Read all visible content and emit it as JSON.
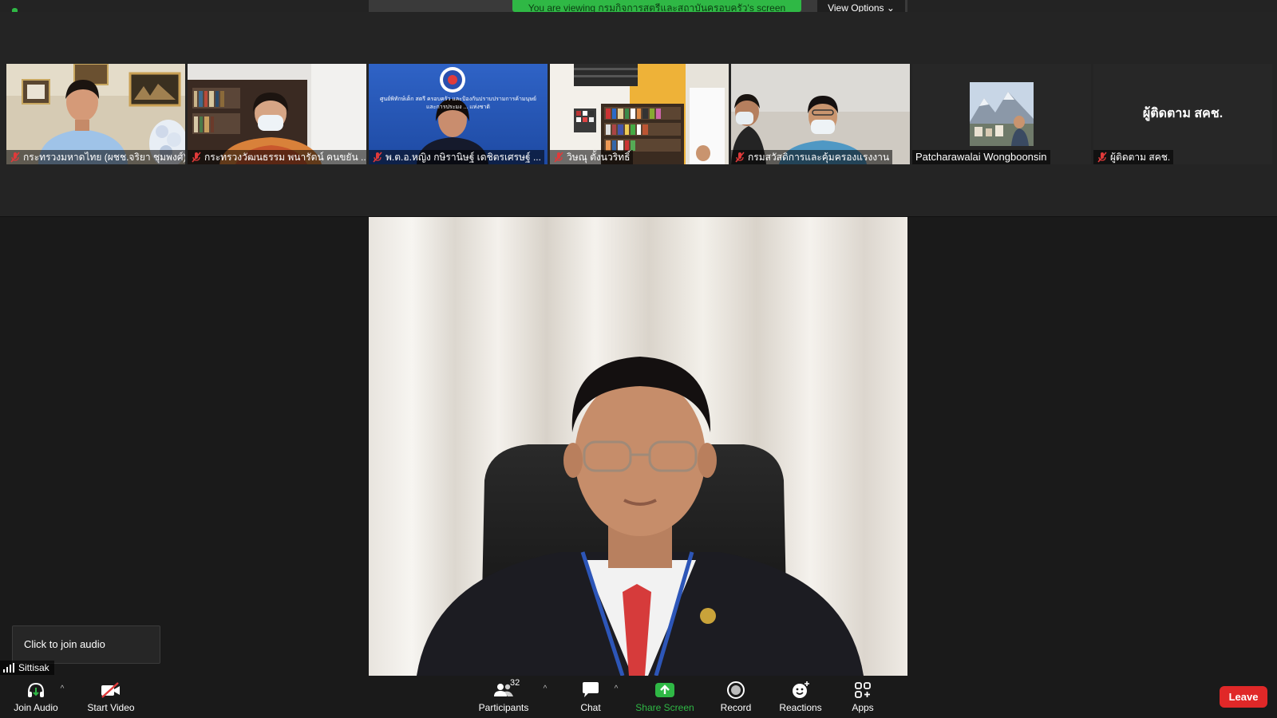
{
  "banner": {
    "viewing_text": "You are viewing กรมกิจการสตรีและสถาบันครอบครัว's screen",
    "view_options_label": "View Options ⌄"
  },
  "gallery": {
    "tiles": [
      {
        "name": "กระทรวงมหาดไทย (ผชช.จริยา ชุมพงศ์)",
        "muted": true
      },
      {
        "name": "กระทรวงวัฒนธรรม พนารัตน์ คนขยัน ...",
        "muted": true
      },
      {
        "name": "พ.ต.อ.หญิง กษิรานิษฐ์ เดชิตรเศรษฐ์ ...",
        "muted": true
      },
      {
        "name": "วิษณุ ตั้งนวริทธิ์",
        "muted": true
      },
      {
        "name": "กรมสวัสดิการและคุ้มครองแรงงาน",
        "muted": true
      },
      {
        "name": "Patcharawalai Wongboonsin",
        "muted": false
      },
      {
        "name": "ผู้ติดตาม สคช.",
        "muted": true,
        "center_label": "ผู้ติดตาม สคช."
      }
    ],
    "tile3_banner_line1": "ศูนย์พิทักษ์เด็ก สตรี ครอบครัว และป้องกันปราบปรามการค้ามนุษย์",
    "tile3_banner_line2": "และการประมง ... แห่งชาติ"
  },
  "popup": {
    "text": "Click to join audio"
  },
  "self_view": {
    "name": "Sittisak"
  },
  "toolbar": {
    "join_audio": "Join Audio",
    "start_video": "Start Video",
    "participants": "Participants",
    "participants_count": "32",
    "chat": "Chat",
    "share_screen": "Share Screen",
    "record": "Record",
    "reactions": "Reactions",
    "apps": "Apps",
    "leave": "Leave"
  },
  "colors": {
    "accent_green": "#2fb845",
    "leave_red": "#e02828",
    "mute_red": "#e03a3a",
    "background": "#1a1a1a"
  }
}
